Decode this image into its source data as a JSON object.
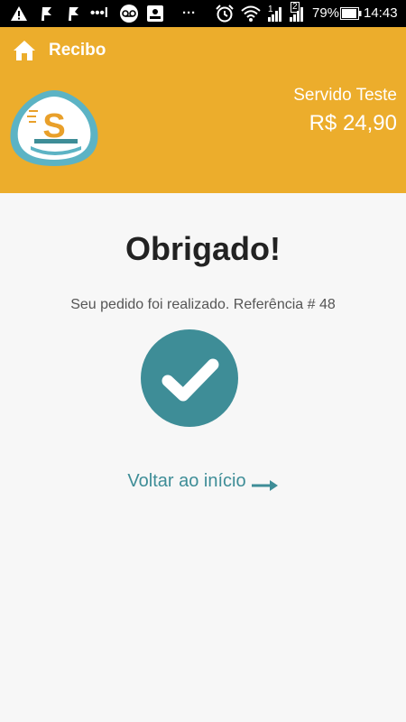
{
  "status_bar": {
    "battery_percent": "79%",
    "time": "14:43",
    "sim1_label": "1",
    "sim2_label": "2",
    "dots": "•••l",
    "more": "···",
    "icons": [
      "warning-icon",
      "flag-icon",
      "flag-icon",
      "voicemail-icon",
      "rec-icon",
      "alarm-icon",
      "wifi-icon",
      "signal-icon",
      "signal-icon",
      "battery-icon"
    ]
  },
  "header": {
    "title": "Recibo",
    "service_name": "Servido Teste",
    "service_price": "R$ 24,90",
    "colors": {
      "background": "#ecad2c",
      "text": "#ffffff"
    }
  },
  "main": {
    "title": "Obrigado!",
    "order_message": "Seu pedido foi realizado. Referência # 48",
    "back_link": "Voltar ao início",
    "colors": {
      "accent": "#3e8d97",
      "background": "#f7f7f7"
    }
  }
}
